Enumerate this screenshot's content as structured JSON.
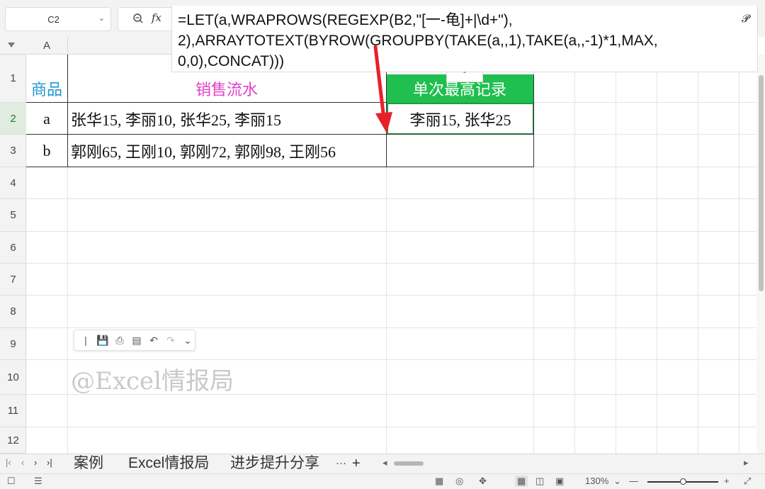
{
  "name_box": {
    "value": "C2"
  },
  "formula_bar": {
    "fx_label": "fx",
    "lines": [
      "=LET(a,WRAPROWS(REGEXP(B2,\"[一-龟]+|\\d+\"),",
      "2),ARRAYTOTEXT(BYROW(GROUPBY(TAKE(a,,1),TAKE(a,,-1)*1,MAX,",
      "0,0),CONCAT)))"
    ],
    "collapse_label": "ˆ"
  },
  "columns": [
    "A"
  ],
  "rows": [
    "1",
    "2",
    "3",
    "4",
    "5",
    "6",
    "7",
    "8",
    "9",
    "10",
    "11",
    "12"
  ],
  "table": {
    "headers": [
      {
        "text": "商品",
        "color": "#1e9ad6"
      },
      {
        "text": "销售流水",
        "color": "#e040c8"
      },
      {
        "text": "单次最高记录",
        "color": "#ffffff",
        "bg": "#1fbf50"
      }
    ],
    "rows": [
      {
        "product": "a",
        "sales": "张华15, 李丽10, 张华25, 李丽15",
        "max": "李丽15,  张华25"
      },
      {
        "product": "b",
        "sales": "郭刚65, 王刚10, 郭刚72, 郭刚98, 王刚56",
        "max": ""
      }
    ]
  },
  "watermark": "@Excel情报局",
  "sheet_tabs": [
    "案例",
    "Excel情报局",
    "进步提升分享"
  ],
  "tab_more": "···",
  "tab_add": "+",
  "status": {
    "zoom": "130%"
  },
  "colors": {
    "accent_green": "#1fbf50",
    "arrow_red": "#e8202a"
  }
}
